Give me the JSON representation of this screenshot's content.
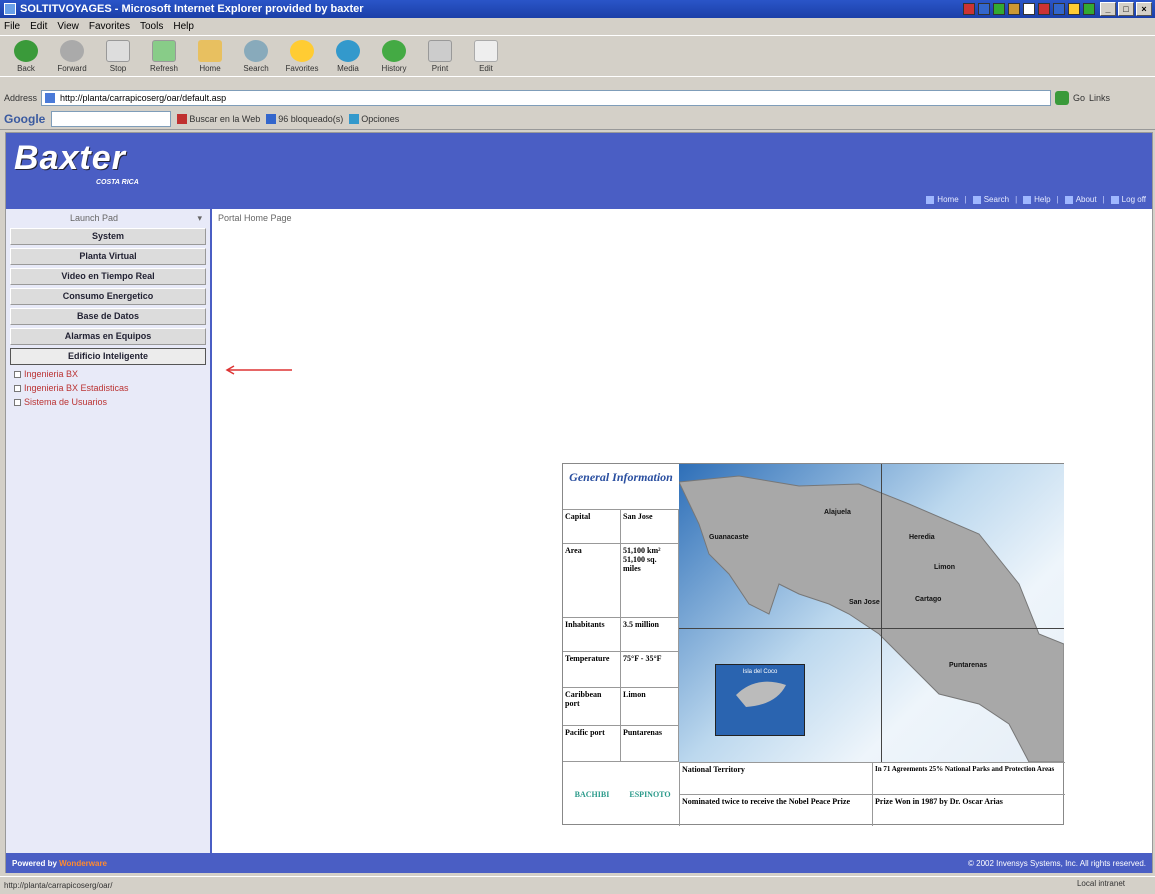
{
  "window": {
    "title": "SOLTITVOYAGES - Microsoft Internet Explorer provided by baxter"
  },
  "menu": [
    "File",
    "Edit",
    "View",
    "Favorites",
    "Tools",
    "Help"
  ],
  "toolbar": [
    "Back",
    "Forward",
    "Stop",
    "Refresh",
    "Home",
    "Search",
    "Favorites",
    "Media",
    "History",
    "Print",
    "Edit"
  ],
  "address": {
    "label": "Address",
    "value": "http://planta/carrapicoserg/oar/default.asp",
    "go": "Go",
    "links": "Links"
  },
  "google": {
    "logo": "Google",
    "search_web": "Buscar en la Web",
    "blocked": "96 bloqueado(s)",
    "options": "Opciones"
  },
  "banner": {
    "logo": "Baxter",
    "sub": "COSTA RICA",
    "links": [
      "Home",
      "Search",
      "Help",
      "About",
      "Log off"
    ]
  },
  "sidebar": {
    "launch": "Launch Pad",
    "items": [
      "System",
      "Planta Virtual",
      "Video en Tiempo Real",
      "Consumo Energetico",
      "Base de Datos",
      "Alarmas en Equipos",
      "Edificio Inteligente"
    ],
    "subitems": [
      "Ingenieria BX",
      "Ingenieria BX Estadisticas",
      "Sistema de Usuarios"
    ]
  },
  "breadcrumb": "Portal Home Page",
  "info": {
    "title": "General Information",
    "rows": [
      {
        "k": "Capital",
        "v": "San Jose"
      },
      {
        "k": "Area",
        "v": "51,100 km²  51,100 sq. miles"
      },
      {
        "k": "Inhabitants",
        "v": "3.5 million"
      },
      {
        "k": "Temperature",
        "v": "75°F - 35°F"
      },
      {
        "k": "Caribbean port",
        "v": "Limon"
      },
      {
        "k": "Pacific port",
        "v": "Puntarenas"
      }
    ],
    "map_labels": [
      "Guanacaste",
      "Alajuela",
      "Heredia",
      "Limon",
      "San Jose",
      "Cartago",
      "Puntarenas"
    ],
    "inset_label": "Isla del Coco",
    "bottom_left": [
      "BACHIBI",
      "ESPINOTO"
    ],
    "bottom_cells": [
      "National Territory",
      "In 71 Agreements 25% National Parks and Protection Areas",
      "Nominated twice to receive the Nobel Peace Prize",
      "Prize Won in 1987 by Dr. Oscar Arias"
    ]
  },
  "footer": {
    "powered": "Powered by",
    "brand": "Wonderware",
    "copyright": "© 2002 Invensys Systems, Inc. All rights reserved."
  },
  "status": {
    "url": "http://planta/carrapicoserg/oar/",
    "zone": "Local intranet"
  }
}
